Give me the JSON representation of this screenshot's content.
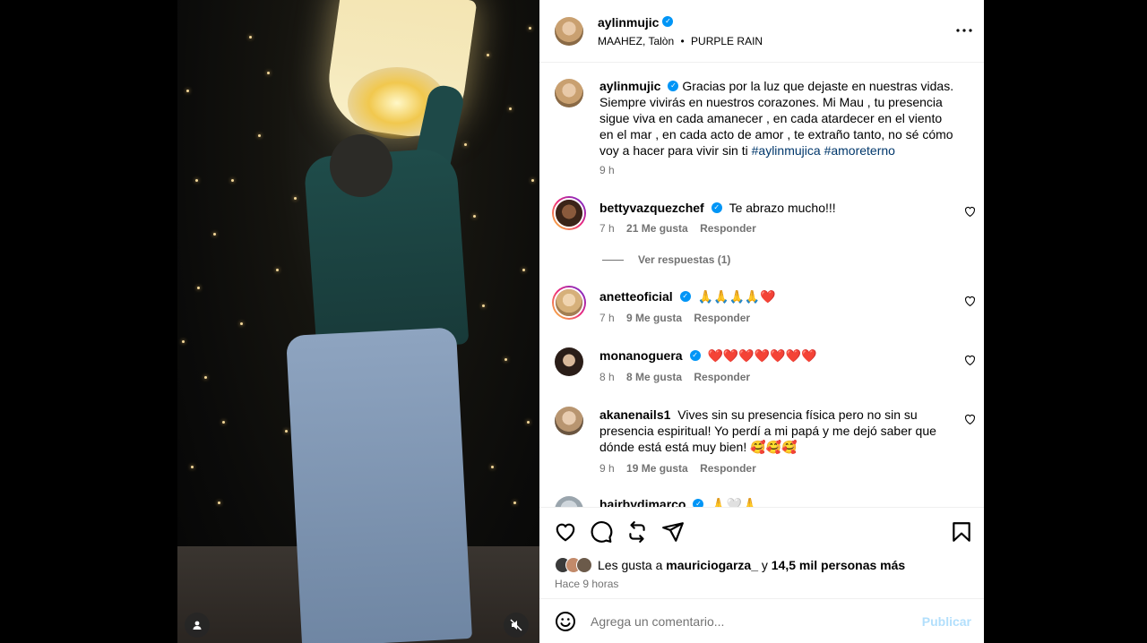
{
  "post": {
    "author": "aylinmujic",
    "location": "MAAHEZ, Talòn",
    "separator": "•",
    "audio": "PURPLE RAIN"
  },
  "caption": {
    "username": "aylinmujic",
    "text": "Gracias por la luz que dejaste en nuestras vidas. Siempre vivirás en nuestros corazones. Mi Mau , tu presencia sigue viva en cada amanecer , en cada atardecer en el viento en el mar , en cada acto de amor , te extraño tanto, no sé cómo voy a hacer para vivir sin ti",
    "hashtag1": "#aylinmujica",
    "hashtag2": "#amoreterno",
    "time": "9 h"
  },
  "comments": [
    {
      "username": "bettyvazquezchef",
      "text": "Te abrazo mucho!!!",
      "time": "7 h",
      "likes": "21 Me gusta",
      "reply": "Responder",
      "view_replies": "Ver respuestas (1)"
    },
    {
      "username": "anetteoficial",
      "text": "🙏🙏🙏🙏❤️",
      "time": "7 h",
      "likes": "9 Me gusta",
      "reply": "Responder"
    },
    {
      "username": "monanoguera",
      "text": "❤️❤️❤️❤️❤️❤️❤️",
      "time": "8 h",
      "likes": "8 Me gusta",
      "reply": "Responder"
    },
    {
      "username": "akanenails1",
      "text": "Vives sin su presencia física pero no sin su presencia espiritual! Yo perdí a mi papá y me dejó saber que dónde está está muy bien! 🥰🥰🥰",
      "time": "9 h",
      "likes": "19 Me gusta",
      "reply": "Responder"
    },
    {
      "username": "hairbydimarco",
      "text": "🙏🤍🙏"
    }
  ],
  "likes": {
    "prefix": "Les gusta a",
    "user": "mauriciogarza_",
    "connector": "y",
    "others": "14,5 mil personas más",
    "time_ago": "Hace 9 horas"
  },
  "composer": {
    "placeholder": "Agrega un comentario...",
    "publish": "Publicar"
  },
  "colors": {
    "verified": "#0095f6",
    "link": "#00376b",
    "muted": "#737373",
    "publish": "#b2dffc"
  },
  "icons": [
    "verified-icon",
    "more-icon",
    "like-icon",
    "comment-icon",
    "repost-icon",
    "share-icon",
    "save-icon",
    "emoji-icon",
    "user-icon",
    "mute-icon",
    "heart-small-icon"
  ]
}
